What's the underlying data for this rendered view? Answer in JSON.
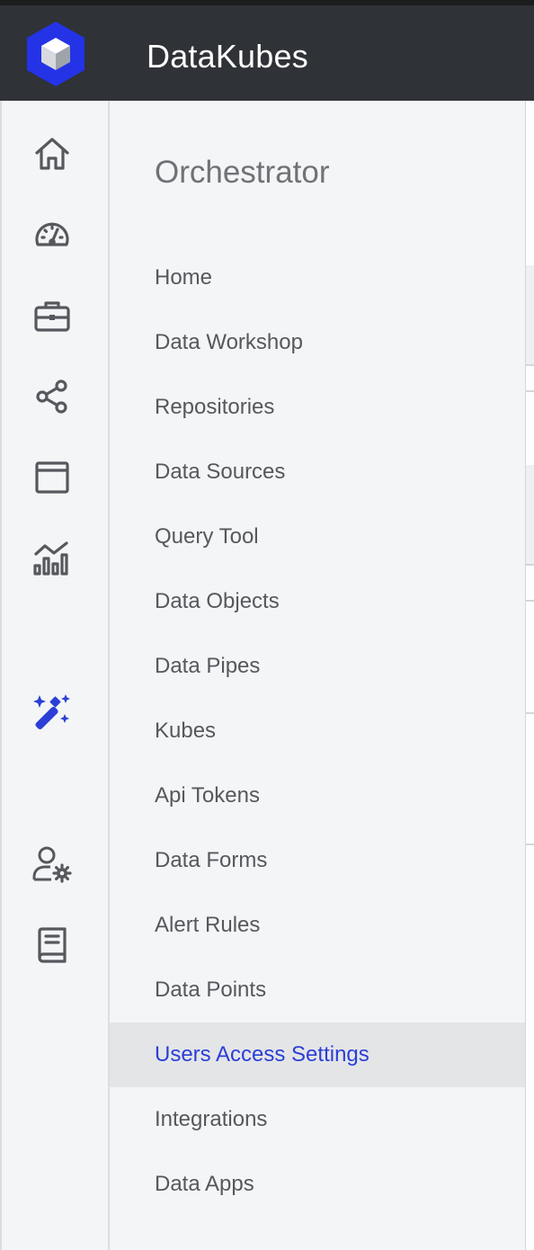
{
  "app": {
    "title": "DataKubes",
    "brand_color": "#2b3fd6"
  },
  "rail": {
    "items": [
      {
        "icon": "home-icon",
        "active": false
      },
      {
        "icon": "dashboard-gauge-icon",
        "active": false
      },
      {
        "icon": "briefcase-icon",
        "active": false
      },
      {
        "icon": "share-nodes-icon",
        "active": false
      },
      {
        "icon": "browser-window-icon",
        "active": false
      },
      {
        "icon": "chart-analytics-icon",
        "active": false
      },
      {
        "icon": "magic-wand-icon",
        "active": true
      },
      {
        "icon": "user-settings-icon",
        "active": false
      },
      {
        "icon": "book-icon",
        "active": false
      }
    ]
  },
  "nav": {
    "title": "Orchestrator",
    "items": [
      {
        "label": "Home"
      },
      {
        "label": "Data Workshop"
      },
      {
        "label": "Repositories"
      },
      {
        "label": "Data Sources"
      },
      {
        "label": "Query Tool"
      },
      {
        "label": "Data Objects"
      },
      {
        "label": "Data Pipes"
      },
      {
        "label": "Kubes"
      },
      {
        "label": "Api Tokens"
      },
      {
        "label": "Data Forms"
      },
      {
        "label": "Alert Rules"
      },
      {
        "label": "Data Points"
      },
      {
        "label": "Users Access Settings",
        "active": true
      },
      {
        "label": "Integrations"
      },
      {
        "label": "Data Apps"
      }
    ]
  }
}
